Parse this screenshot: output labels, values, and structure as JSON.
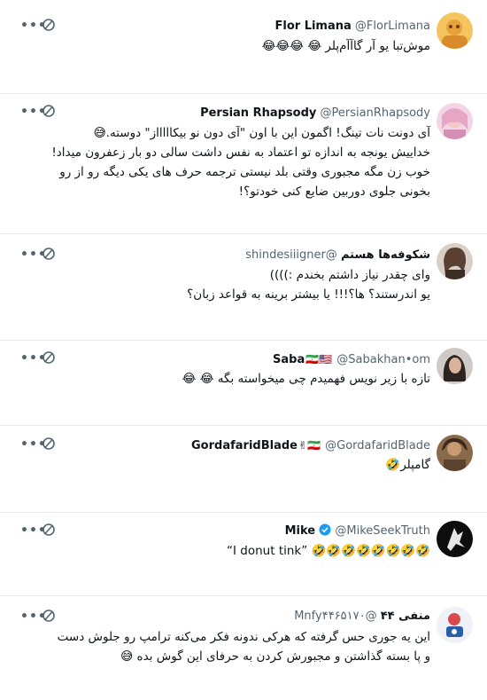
{
  "tweets": [
    {
      "name": "Flor Limana",
      "handle": "@FlorLimana",
      "flag": "",
      "verified": false,
      "text": "موش‌تبا  یو  آر  گاآآم‌پلر  😂  😂😂😂"
    },
    {
      "name": "Persian Rhapsody",
      "handle": "@PersianRhapsody",
      "flag": "",
      "verified": false,
      "text": "آی دونت نات تینگ! اگمون این با اون \"آی دون نو بیکاااااز\" دوسته.😅\nخداییش یونجه به اندازه تو اعتماد به نفس داشت سالی دو بار زعفرون میداد! خوب زن مگه مجبوری وقتی بلد نیستی ترجمه حرف های یکی دیگه رو از رو بخونی جلوی دوربین ضایع کنی خودتو؟!"
    },
    {
      "name": "شکوفه‌ها هستم",
      "handle": "@shindesiiigner",
      "flag": "",
      "verified": false,
      "text": "وای چقدر نیاز داشتم بخندم :))))\nیو اندرستند؟ ها؟!!! یا بیشتر برینه به قواعد زبان؟"
    },
    {
      "name": "Saba",
      "handle": "@Sabakhan•om",
      "flag": "🇮🇷🇺🇸",
      "verified": false,
      "text": "تازه با زیر نویس فهمیدم چی میخواسته بگه 😂 😂"
    },
    {
      "name": "GordafaridBlade",
      "handle": "@GordafaridBlade",
      "flag": "🇮🇷✌",
      "verified": false,
      "text": "گامپلر🤣"
    },
    {
      "name": "Mike",
      "handle": "@MikeSeekTruth",
      "flag": "",
      "verified": true,
      "text": "“I donut tink” 🤣🤣🤣🤣🤣🤣🤣🤣"
    },
    {
      "name": "منفی ۴۴",
      "handle": "@Mnfy۴۴۶۵۱۷۰",
      "flag": "",
      "verified": false,
      "text": "این یه جوری حس گرفته که هرکی ندونه فکر می‌کنه ترامپ رو جلوش دست و پا بسته گذاشتن و مجبورش کردن به حرفای این گوش بده 😅"
    }
  ],
  "actions": {
    "more_label": "•••"
  },
  "colors": {
    "name": "#0f1419",
    "handle": "#536471",
    "divider": "#e6e9eb",
    "verified": "#1d9bf0"
  }
}
